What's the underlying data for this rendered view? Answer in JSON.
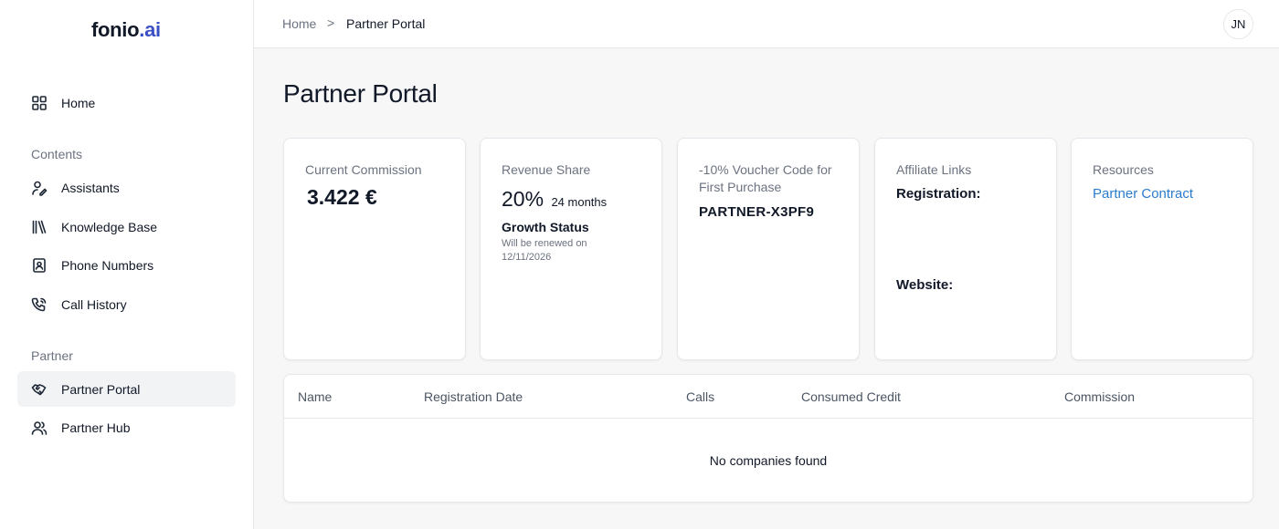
{
  "app": {
    "logo_main": "fonio",
    "logo_suffix": ".ai"
  },
  "sidebar": {
    "home": {
      "label": "Home",
      "icon": "grid-icon"
    },
    "contents_section": "Contents",
    "contents": [
      {
        "label": "Assistants",
        "icon": "assistant-icon"
      },
      {
        "label": "Knowledge Base",
        "icon": "books-icon"
      },
      {
        "label": "Phone Numbers",
        "icon": "contact-book-icon"
      },
      {
        "label": "Call History",
        "icon": "phone-call-icon"
      }
    ],
    "partner_section": "Partner",
    "partner": [
      {
        "label": "Partner Portal",
        "icon": "handshake-icon",
        "active": true
      },
      {
        "label": "Partner Hub",
        "icon": "users-icon"
      }
    ]
  },
  "header": {
    "breadcrumb_home": "Home",
    "breadcrumb_sep": ">",
    "breadcrumb_current": "Partner Portal",
    "avatar_initials": "JN"
  },
  "main": {
    "title": "Partner Portal",
    "cards": {
      "commission": {
        "label": "Current Commission",
        "value": "3.422 €"
      },
      "revenue": {
        "label": "Revenue Share",
        "value": "20%",
        "duration": "24 months",
        "growth_title": "Growth Status",
        "growth_note": "Will be renewed on 12/11/2026"
      },
      "voucher": {
        "label": "-10% Voucher Code for First Purchase",
        "code": "PARTNER-X3PF9"
      },
      "affiliate": {
        "label": "Affiliate Links",
        "registration": "Registration:",
        "website": "Website:"
      },
      "resources": {
        "label": "Resources",
        "link": "Partner Contract"
      }
    },
    "table": {
      "columns": [
        "Name",
        "Registration Date",
        "Calls",
        "Consumed Credit",
        "Commission"
      ],
      "empty_message": "No companies found"
    }
  },
  "colors": {
    "accent_link": "#2b7bce",
    "logo_accent": "#3b4fc4",
    "active_nav_bg": "#f1f3f5"
  }
}
